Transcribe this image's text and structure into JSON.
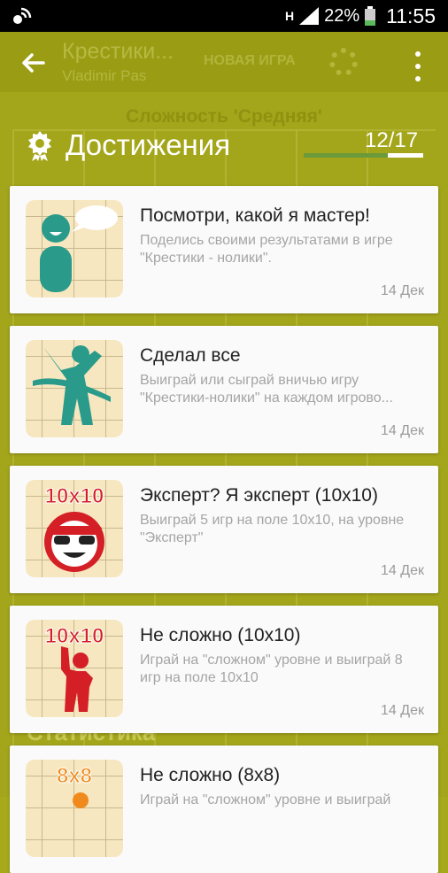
{
  "status_bar": {
    "network": "H",
    "battery": "22%",
    "time": "11:55"
  },
  "background": {
    "app_title": "Крестики...",
    "user_name": "Vladimir Pas",
    "new_game": "НОВАЯ ИГРА",
    "level": "Сложность 'Средняя'",
    "stats": "Статистика"
  },
  "header": {
    "title": "Достижения",
    "counter": "12/17",
    "progress": 0.706
  },
  "achievements": [
    {
      "title": "Посмотри, какой я мастер!",
      "desc": "Поделись своими результатами в игре \"Крестики - нолики\".",
      "date": "14 Дек",
      "icon": "talking-person-icon",
      "badge": ""
    },
    {
      "title": "Сделал все",
      "desc": "Выиграй или сыграй вничью игру \"Крестики-нолики\" на каждом игрово...",
      "date": "14 Дек",
      "icon": "finish-line-person-icon",
      "badge": ""
    },
    {
      "title": "Эксперт? Я эксперт (10x10)",
      "desc": "Выиграй 5 игр на поле 10x10, на уровне \"Эксперт\"",
      "date": "14 Дек",
      "icon": "expert-face-icon",
      "badge": "10x10"
    },
    {
      "title": "Не сложно (10x10)",
      "desc": "Играй на \"сложном\" уровне и выиграй 8 игр на поле 10x10",
      "date": "14 Дек",
      "icon": "raised-fist-person-icon",
      "badge": "10x10"
    },
    {
      "title": "Не сложно (8x8)",
      "desc": "Играй на \"сложном\" уровне и выиграй",
      "date": "",
      "icon": "raised-fist-person-icon",
      "badge": "8x8"
    }
  ]
}
